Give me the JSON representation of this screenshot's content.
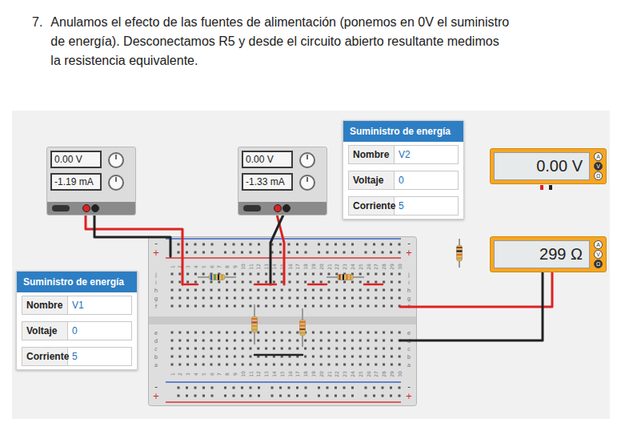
{
  "instruction": {
    "number": "7.",
    "lines": [
      "Anulamos el efecto de las fuentes de alimentación (ponemos en 0V el suministro",
      "de energía). Desconectamos R5 y desde el circuito abierto resultante medimos",
      "la resistencia equivalente."
    ]
  },
  "power_supplies": [
    {
      "voltage": "0.00 V",
      "current": "-1.19 mA"
    },
    {
      "voltage": "0.00 V",
      "current": "-1.33 mA"
    }
  ],
  "property_panels": [
    {
      "title": "Suministro de energía",
      "fields": [
        {
          "label": "Nombre",
          "value": "V2"
        },
        {
          "label": "Voltaje",
          "value": "0"
        },
        {
          "label": "Corriente",
          "value": "5"
        }
      ]
    },
    {
      "title": "Suministro de energía",
      "fields": [
        {
          "label": "Nombre",
          "value": "V1"
        },
        {
          "label": "Voltaje",
          "value": "0"
        },
        {
          "label": "Corriente",
          "value": "5"
        }
      ]
    }
  ],
  "multimeters": [
    {
      "reading": "0.00 V",
      "modes": [
        {
          "label": "A",
          "selected": false
        },
        {
          "label": "V",
          "selected": true
        },
        {
          "label": "Ω",
          "selected": false
        }
      ]
    },
    {
      "reading": "299 Ω",
      "modes": [
        {
          "label": "A",
          "selected": false
        },
        {
          "label": "V",
          "selected": false
        },
        {
          "label": "Ω",
          "selected": true
        }
      ]
    }
  ],
  "breadboard": {
    "rail_labels": [
      "-",
      "+"
    ],
    "letters_top": [
      "j",
      "i",
      "h",
      "g",
      "f"
    ],
    "letters_bottom": [
      "e",
      "d",
      "c",
      "b",
      "a"
    ],
    "numbers": [
      "1",
      "2",
      "3",
      "4",
      "5",
      "6",
      "7",
      "8",
      "9",
      "10",
      "11",
      "12",
      "13",
      "14",
      "15",
      "16",
      "17",
      "18",
      "19",
      "20",
      "21",
      "22",
      "23",
      "24",
      "25",
      "26",
      "27",
      "28",
      "29",
      "30"
    ]
  }
}
